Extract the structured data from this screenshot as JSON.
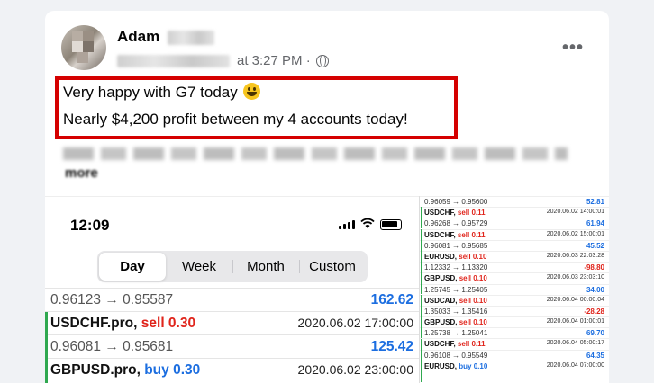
{
  "post": {
    "author": "Adam",
    "time": "at 3:27 PM ·",
    "more_label": "•••",
    "line1": "Very happy with G7 today",
    "line2": "Nearly $4,200 profit between my 4 accounts today!",
    "see_more": "more"
  },
  "phone": {
    "clock": "12:09",
    "tabs": [
      "Day",
      "Week",
      "Month",
      "Custom"
    ],
    "rows": [
      {
        "left": "0.96123 → 0.95587",
        "right": "162.62"
      },
      {
        "sym": "USDCHF.pro,",
        "side": "sell 0.30",
        "right": "2020.06.02 17:00:00"
      },
      {
        "left": "0.96081 → 0.95681",
        "right": "125.42"
      },
      {
        "sym": "GBPUSD.pro,",
        "side": "buy 0.30",
        "right": "2020.06.02 23:00:00"
      }
    ]
  },
  "side": {
    "rows": [
      {
        "left": "0.96059 → 0.95600",
        "right": "52.81",
        "kind": "pos"
      },
      {
        "sym": "USDCHF,",
        "side": "sell 0.11",
        "right": "2020.06.02 14:00:01",
        "kind": "dt",
        "dir": "sell"
      },
      {
        "left": "0.96268 → 0.95729",
        "right": "61.94",
        "kind": "pos"
      },
      {
        "sym": "USDCHF,",
        "side": "sell 0.11",
        "right": "2020.06.02 15:00:01",
        "kind": "dt",
        "dir": "sell"
      },
      {
        "left": "0.96081 → 0.95685",
        "right": "45.52",
        "kind": "pos"
      },
      {
        "sym": "EURUSD,",
        "side": "sell 0.10",
        "right": "2020.06.03 22:03:28",
        "kind": "dt",
        "dir": "sell"
      },
      {
        "left": "1.12332 → 1.13320",
        "right": "-98.80",
        "kind": "neg"
      },
      {
        "sym": "GBPUSD,",
        "side": "sell 0.10",
        "right": "2020.06.03 23:03:10",
        "kind": "dt",
        "dir": "sell"
      },
      {
        "left": "1.25745 → 1.25405",
        "right": "34.00",
        "kind": "pos"
      },
      {
        "sym": "USDCAD,",
        "side": "sell 0.10",
        "right": "2020.06.04 00:00:04",
        "kind": "dt",
        "dir": "sell"
      },
      {
        "left": "1.35033 → 1.35416",
        "right": "-28.28",
        "kind": "neg"
      },
      {
        "sym": "GBPUSD,",
        "side": "sell 0.10",
        "right": "2020.06.04 01:00:01",
        "kind": "dt",
        "dir": "sell"
      },
      {
        "left": "1.25738 → 1.25041",
        "right": "69.70",
        "kind": "pos"
      },
      {
        "sym": "USDCHF,",
        "side": "sell 0.11",
        "right": "2020.06.04 05:00:17",
        "kind": "dt",
        "dir": "sell"
      },
      {
        "left": "0.96108 → 0.95549",
        "right": "64.35",
        "kind": "pos"
      },
      {
        "sym": "EURUSD,",
        "side": "buy 0.10",
        "right": "2020.06.04 07:00:00",
        "kind": "dt",
        "dir": "buy"
      }
    ]
  }
}
